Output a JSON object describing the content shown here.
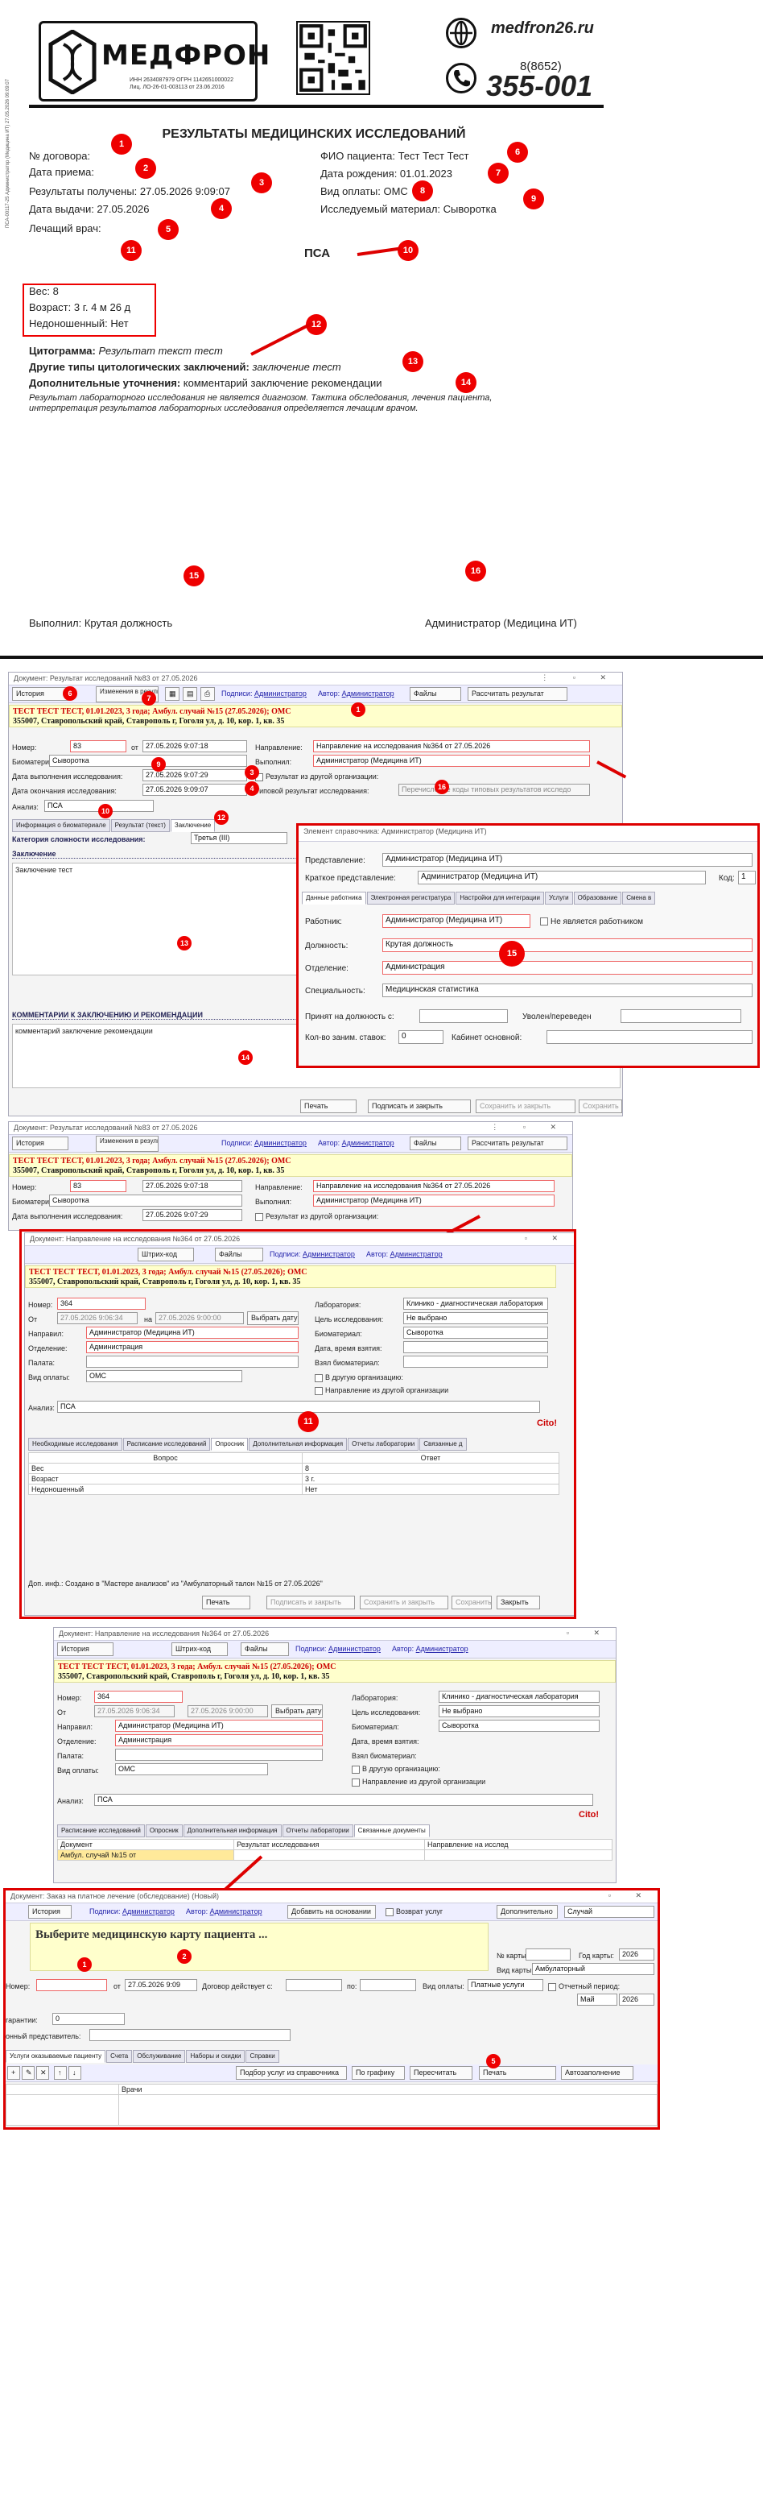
{
  "report": {
    "logo": "МЕДФРОН",
    "license_l1": "ИНН 2634087979 ОГРН 1142651000022",
    "license_l2": "Лиц. ЛО-26-01-003113 от 23.06.2016",
    "side_text": "ПСА-00117-25 Администратор (Медицина ИТ) 27.05.2026 09:09:07",
    "site": "medfron26.ru",
    "code": "8(8652)",
    "phone": "355-001",
    "title": "РЕЗУЛЬТАТЫ МЕДИЦИНСКИХ ИССЛЕДОВАНИЙ",
    "contract": "№ договора:",
    "admission": "Дата приема:",
    "results": "Результаты получены: 27.05.2026 9:09:07",
    "issue": "Дата выдачи:   27.05.2026",
    "doctor": "Лечащий врач:",
    "patient": "ФИО пациента: Тест Тест Тест",
    "birth": "Дата рождения: 01.01.2023",
    "pay": "Вид оплаты:  ОМС",
    "material": "Исследуемый материал:  Сыворотка",
    "analysis": "ПСА",
    "weight": "Вес: 8",
    "age": "Возраст: 3 г. 4 м 26 д",
    "premature": "Недоношенный: Нет",
    "cyto_l": "Цитограмма:",
    "cyto_v": "Результат текст тест",
    "other_l": "Другие типы цитологических заключений:",
    "other_v": "заключение тест",
    "add_l": "Дополнительные уточнения:",
    "add_v": "комментарий заключение рекомендации",
    "disclaimer1": "Результат лабораторного исследования не является диагнозом. Тактика обследования, лечения пациента,",
    "disclaimer2": "интерпретация результатов лабораторных исследования определяется лечащим врачом.",
    "performer": "Выполнил: Крутая должность",
    "admin": "Администратор (Медицина ИТ)"
  },
  "w1": {
    "title": "Документ: Результат исследований №83 от 27.05.2026",
    "btn_history": "История",
    "btn_changes": "Изменения в результатах",
    "signs": "Подписи:",
    "signs_v": "Администратор",
    "author": "Автор:",
    "author_v": "Администратор",
    "btn_files": "Файлы",
    "btn_calc": "Рассчитать результат",
    "patient": "ТЕСТ ТЕСТ ТЕСТ, 01.01.2023, 3 года; Амбул. случай №15 (27.05.2026); ОМС",
    "address": "355007, Ставропольский край, Ставрополь г, Гоголя ул, д. 10, кор. 1, кв. 35",
    "l_number": "Номер:",
    "v_number": "83",
    "l_from": "от",
    "v_from": "27.05.2026 9:07:18",
    "l_dir": "Направление:",
    "v_dir": "Направление на исследования №364 от 27.05.2026",
    "l_bio": "Биоматериал:",
    "v_bio": "Сыворотка",
    "l_exec": "Выполнил:",
    "v_exec": "Администратор (Медицина ИТ)",
    "l_dstart": "Дата выполнения исследования:",
    "v_dstart": "27.05.2026 9:07:29",
    "l_other": "Результат из другой организации:",
    "l_dend": "Дата окончания исследования:",
    "v_dend": "27.05.2026 9:09:07",
    "l_type": "Типовой результат исследования:",
    "p_type": "Перечисление коды типовых результатов исследо",
    "l_analysis": "Анализ:",
    "v_analysis": "ПСА",
    "tabs": [
      "Информация о биоматериале",
      "Результат (текст)",
      "Заключение"
    ],
    "l_cat": "Категория сложности исследования:",
    "v_cat": "Третья (III)",
    "s_concl": "Заключение",
    "v_concl": "Заключение тест",
    "s_comment": "КОММЕНТАРИИ К ЗАКЛЮЧЕНИЮ И РЕКОМЕНДАЦИИ",
    "v_comment": "комментарий заключение рекомендации",
    "btn_print": "Печать",
    "btn_sign": "Подписать и закрыть",
    "btn_save_close": "Сохранить и закрыть",
    "btn_save": "Сохранить"
  },
  "d1": {
    "title": "Элемент справочника: Администратор (Медицина ИТ)",
    "l_repr": "Представление:",
    "v_repr": "Администратор (Медицина ИТ)",
    "l_short": "Краткое представление:",
    "v_short": "Администратор (Медицина ИТ)",
    "l_code": "Код:",
    "v_code": "1",
    "tabs": [
      "Данные работника",
      "Электронная регистратура",
      "Настройки для интеграции",
      "Услуги",
      "Образование",
      "Смена в"
    ],
    "l_worker": "Работник:",
    "v_worker": "Администратор (Медицина ИТ)",
    "l_notworker": "Не является работником",
    "l_pos": "Должность:",
    "v_pos": "Крутая должность",
    "l_dep": "Отделение:",
    "v_dep": "Администрация",
    "l_spec": "Специальность:",
    "v_spec": "Медицинская статистика",
    "l_hired": "Принят на должность с:",
    "l_fired": "Уволен/переведен",
    "l_rates": "Кол-во заним. ставок:",
    "v_rates": "0",
    "l_cab": "Кабинет основной:"
  },
  "w2": {
    "title": "Документ: Результат исследований №83 от 27.05.2026",
    "v_from": "27.05.2026 9:07:18",
    "v_dstart": "27.05.2026 9:07:29",
    "v_exec": "Администратор (Медицина ИТ)"
  },
  "w3": {
    "title": "Документ: Направление на исследования №364 от 27.05.2026",
    "btn_barcode": "Штрих-код",
    "patient": "ТЕСТ ТЕСТ ТЕСТ, 01.01.2023, 3 года; Амбул. случай №15 (27.05.2026); ОМС",
    "address": "355007, Ставропольский край, Ставрополь г, Гоголя ул, д. 10, кор. 1, кв. 35",
    "l_number": "Номер:",
    "v_number": "364",
    "l_from": "От",
    "v_from": "27.05.2026 9:06:34",
    "l_to": "на",
    "v_to": "27.05.2026 9:00:00",
    "btn_pick": "Выбрать дату",
    "l_sent": "Направил:",
    "v_sent": "Администратор (Медицина ИТ)",
    "l_dep": "Отделение:",
    "v_dep": "Администрация",
    "l_ward": "Палата:",
    "l_pay": "Вид оплаты:",
    "v_pay": "ОМС",
    "l_lab": "Лаборатория:",
    "v_lab": "Клинико - диагностическая лаборатория",
    "l_goal": "Цель исследования:",
    "v_goal": "Не выбрано",
    "l_bio": "Биоматериал:",
    "v_bio": "Сыворотка",
    "l_time": "Дата, время взятия:",
    "l_took": "Взял биоматериал:",
    "l_otherorg": "В другую организацию:",
    "l_fromorg": "Направление из другой организации",
    "l_analysis": "Анализ:",
    "v_analysis": "ПСА",
    "cito": "Cito!",
    "tabs": [
      "Необходимые исследования",
      "Расписание исследований",
      "Опросник",
      "Дополнительная информация",
      "Отчеты лаборатории",
      "Связанные д"
    ],
    "th_q": "Вопрос",
    "th_a": "Ответ",
    "rows": [
      [
        "Вес",
        "8"
      ],
      [
        "Возраст",
        "3  г."
      ],
      [
        "Недоношенный",
        "Нет"
      ]
    ],
    "footer": "Доп. инф.: Создано в \"Мастере анализов\" из \"Амбулаторный талон №15 от 27.05.2026\"",
    "btn_print": "Печать",
    "btn_sign": "Подписать и закрыть",
    "btn_save_close": "Сохранить и закрыть",
    "btn_save": "Сохранить",
    "btn_close": "Закрыть"
  },
  "w4": {
    "title": "Документ: Направление на исследования №364 от 27.05.2026",
    "tabs": [
      "Расписание исследований",
      "Опросник",
      "Дополнительная информация",
      "Отчеты лаборатории",
      "Связанные документы"
    ],
    "th1": "Документ",
    "th2": "Результат исследования",
    "th3": "Направление на исслед",
    "row1": "Амбул. случай №15 от"
  },
  "w5": {
    "title": "Документ: Заказ на платное лечение (обследование) (Новый)",
    "btn_bill": "Добавить на основании",
    "l_refund": "Возврат услуг",
    "l_extra": "Дополнительно",
    "v_case": "Случай",
    "headline": "Выберите медицинскую карту пациента ...",
    "l_card": "№ карты:",
    "l_year": "Год карты:",
    "v_year": "2026",
    "l_cardtype": "Вид карты:",
    "v_cardtype": "Амбулаторный",
    "l_number": "Номер:",
    "l_from": "от",
    "v_from": "27.05.2026 9:09",
    "l_contract": "Договор действует с:",
    "l_to": "по:",
    "l_pay": "Вид оплаты:",
    "v_pay": "Платные услуги",
    "l_period": "Отчетный период:",
    "v_month": "Май",
    "v_pyear": "2026",
    "l_guarantee": "гарантии:",
    "v_guarantee": "0",
    "l_rep": "онный представитель:",
    "tabs": [
      "Услуги оказываемые пациенту",
      "Счета",
      "Обслуживание",
      "Наборы и скидки",
      "Справки"
    ],
    "btn_pick": "Подбор услуг из справочника",
    "btn_graph": "По графику",
    "btn_recalc": "Пересчитать",
    "btn_print": "Печать",
    "btn_auto": "Автозаполнение",
    "th": "Врачи"
  }
}
